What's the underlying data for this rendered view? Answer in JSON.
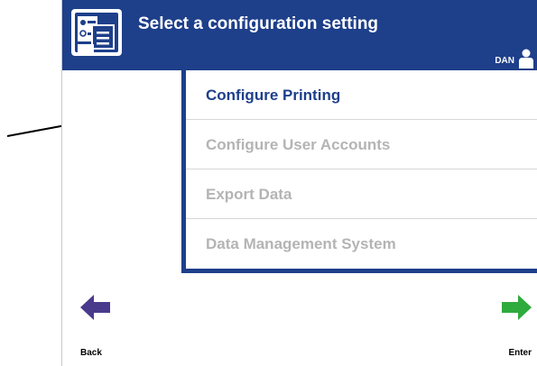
{
  "header": {
    "title": "Select a configuration setting",
    "user": "DAN",
    "app_icon": "configuration-icon",
    "user_icon": "user-icon",
    "background_color": "#1e3f8a"
  },
  "menu": {
    "items": [
      {
        "label": "Configure Printing",
        "state": "active"
      },
      {
        "label": "Configure User Accounts",
        "state": "disabled"
      },
      {
        "label": "Export Data",
        "state": "disabled"
      },
      {
        "label": "Data Management System",
        "state": "disabled"
      }
    ]
  },
  "footer": {
    "back_label": "Back",
    "enter_label": "Enter",
    "back_icon": "back-arrow-icon",
    "enter_icon": "enter-arrow-icon",
    "back_color": "#4a3a8c",
    "enter_color": "#2faa3c"
  },
  "annotation": {
    "icon": "pointer-arrow-icon"
  }
}
